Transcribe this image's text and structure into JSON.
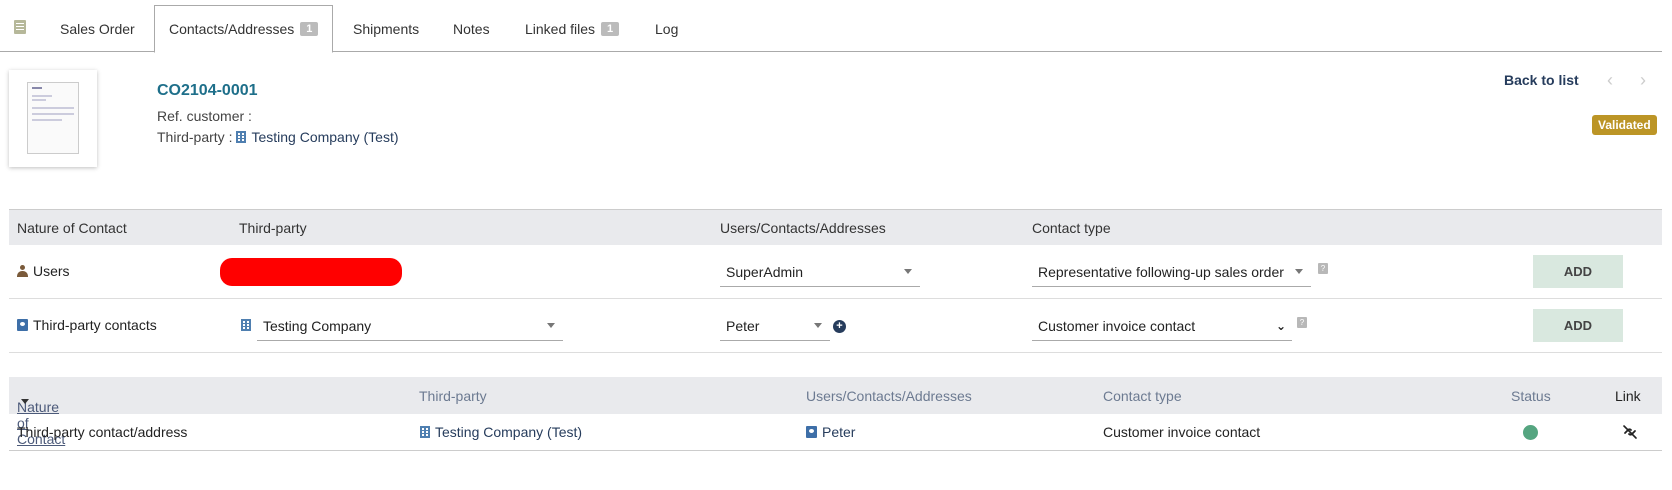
{
  "tabs": [
    {
      "label": "Sales Order"
    },
    {
      "label": "Contacts/Addresses",
      "badge": "1",
      "active": true
    },
    {
      "label": "Shipments"
    },
    {
      "label": "Notes"
    },
    {
      "label": "Linked files",
      "badge": "1"
    },
    {
      "label": "Log"
    }
  ],
  "header": {
    "ref": "CO2104-0001",
    "ref_customer_label": "Ref. customer :",
    "third_party_label": "Third-party :",
    "third_party_name": "Testing Company (Test)",
    "back_to_list": "Back to list",
    "prev_arrow": "‹",
    "next_arrow": "›",
    "status": "Validated",
    "status_color": "#bc9526"
  },
  "add_table": {
    "headers": {
      "nature": "Nature of Contact",
      "third_party": "Third-party",
      "users": "Users/Contacts/Addresses",
      "contact_type": "Contact type"
    },
    "rows": [
      {
        "nature": "Users",
        "icon": "user-icon",
        "user_select": "SuperAdmin",
        "contact_type": "Representative following-up sales order",
        "help": "?",
        "button": "ADD"
      },
      {
        "nature": "Third-party contacts",
        "icon": "contact-card-icon",
        "third_party_select": "Testing Company",
        "contact_select": "Peter",
        "contact_type": "Customer invoice contact",
        "help": "?",
        "button": "ADD"
      }
    ]
  },
  "list_table": {
    "headers": {
      "nature": "Nature of Contact",
      "third_party": "Third-party",
      "users": "Users/Contacts/Addresses",
      "contact_type": "Contact type",
      "status": "Status",
      "link": "Link"
    },
    "rows": [
      {
        "nature": "Third-party contact/address",
        "third_party": "Testing Company (Test)",
        "contact": "Peter",
        "contact_type": "Customer invoice contact",
        "status_color": "#55a580"
      }
    ]
  }
}
